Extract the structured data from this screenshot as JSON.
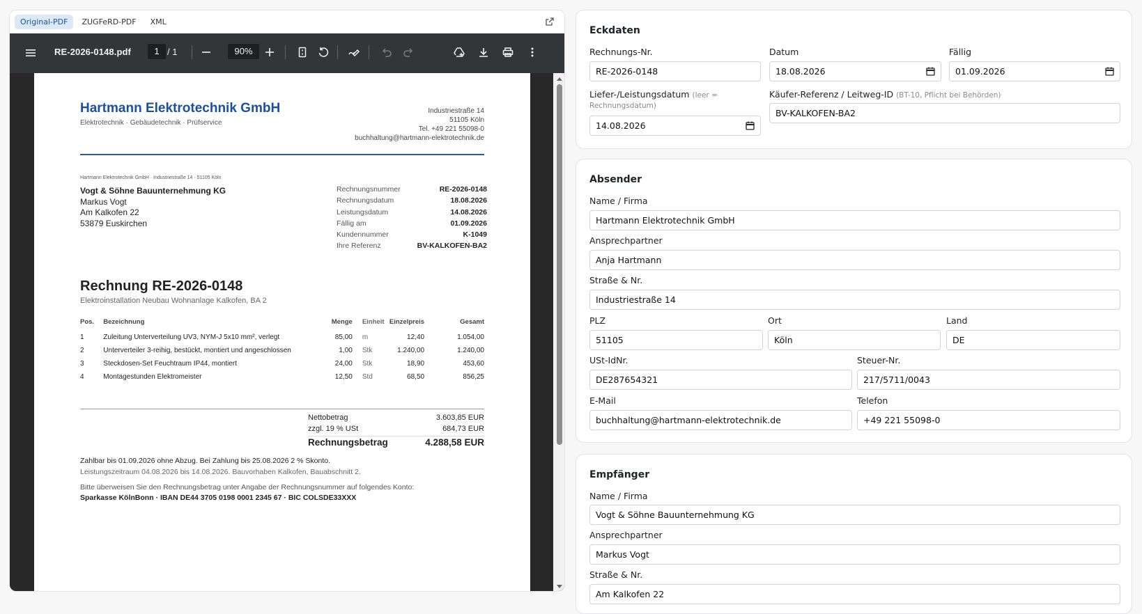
{
  "viewer": {
    "tabs": [
      {
        "label": "Original-PDF",
        "active": true
      },
      {
        "label": "ZUGFeRD-PDF",
        "active": false
      },
      {
        "label": "XML",
        "active": false
      }
    ]
  },
  "pdf_toolbar": {
    "filename": "RE-2026-0148.pdf",
    "page_current": "1",
    "page_total": "/  1",
    "zoom": "90%"
  },
  "invoice": {
    "company_name": "Hartmann Elektrotechnik GmbH",
    "company_tagline": "Elektrotechnik · Gebäudetechnik · Prüfservice",
    "company_address": [
      "Industriestraße 14",
      "51105 Köln",
      "Tel. +49 221 55098-0",
      "buchhaltung@hartmann-elektrotechnik.de"
    ],
    "sender_line": "Hartmann Elektrotechnik GmbH · Industriestraße 14 · 51105 Köln",
    "recipient": [
      "Vogt & Söhne Bauunternehmung KG",
      "Markus Vogt",
      "Am Kalkofen 22",
      "53879 Euskirchen"
    ],
    "meta": [
      {
        "k": "Rechnungsnummer",
        "v": "RE-2026-0148"
      },
      {
        "k": "Rechnungsdatum",
        "v": "18.08.2026"
      },
      {
        "k": "Leistungsdatum",
        "v": "14.08.2026"
      },
      {
        "k": "Fällig am",
        "v": "01.09.2026"
      },
      {
        "k": "Kundennummer",
        "v": "K-1049"
      },
      {
        "k": "Ihre Referenz",
        "v": "BV-KALKOFEN-BA2"
      }
    ],
    "title": "Rechnung RE-2026-0148",
    "subtitle": "Elektroinstallation Neubau Wohnanlage Kalkofen, BA 2",
    "columns": [
      "Pos.",
      "Bezeichnung",
      "Menge",
      "Einheit",
      "Einzelpreis",
      "Gesamt"
    ],
    "items": [
      {
        "pos": "1",
        "desc": "Zuleitung Unterverteilung UV3, NYM-J 5x10 mm², verlegt",
        "qty": "85,00",
        "unit": "m",
        "price": "12,40",
        "total": "1.054,00"
      },
      {
        "pos": "2",
        "desc": "Unterverteiler 3-reihig, bestückt, montiert und angeschlossen",
        "qty": "1,00",
        "unit": "Stk",
        "price": "1.240,00",
        "total": "1.240,00"
      },
      {
        "pos": "3",
        "desc": "Steckdosen-Set Feuchtraum IP44, montiert",
        "qty": "24,00",
        "unit": "Stk",
        "price": "18,90",
        "total": "453,60"
      },
      {
        "pos": "4",
        "desc": "Montagestunden Elektromeister",
        "qty": "12,50",
        "unit": "Std",
        "price": "68,50",
        "total": "856,25"
      }
    ],
    "totals": [
      {
        "k": "Nettobetrag",
        "v": "3.603,85 EUR"
      },
      {
        "k": "zzgl. 19 % USt",
        "v": "684,73 EUR"
      },
      {
        "k": "Rechnungsbetrag",
        "v": "4.288,58 EUR"
      }
    ],
    "payment_terms": "Zahlbar bis 01.09.2026 ohne Abzug. Bei Zahlung bis 25.08.2026 2 % Skonto.",
    "service_period": "Leistungszeitraum 04.08.2026 bis 14.08.2026. Bauvorhaben Kalkofen, Bauabschnitt 2.",
    "transfer_note": "Bitte überweisen Sie den Rechnungsbetrag unter Angabe der Rechnungsnummer auf folgendes Konto:",
    "bank": "Sparkasse KölnBonn · IBAN DE44 3705 0198 0001 2345 67 · BIC COLSDE33XXX"
  },
  "form": {
    "eckdaten": {
      "title": "Eckdaten",
      "rechnungsnr_label": "Rechnungs-Nr.",
      "rechnungsnr": "RE-2026-0148",
      "datum_label": "Datum",
      "datum": "18.08.2026",
      "faellig_label": "Fällig",
      "faellig": "01.09.2026",
      "liefer_label": "Liefer-/Leistungsdatum",
      "liefer_hint_1": "(leer =",
      "liefer_hint_2": "Rechnungsdatum)",
      "liefer": "14.08.2026",
      "kaeufer_label": "Käufer-Referenz / Leitweg-ID",
      "kaeufer_hint": "(BT-10, Pflicht bei Behörden)",
      "kaeufer": "BV-KALKOFEN-BA2"
    },
    "absender": {
      "title": "Absender",
      "name_label": "Name / Firma",
      "name": "Hartmann Elektrotechnik GmbH",
      "contact_label": "Ansprechpartner",
      "contact": "Anja Hartmann",
      "street_label": "Straße & Nr.",
      "street": "Industriestraße 14",
      "plz_label": "PLZ",
      "plz": "51105",
      "ort_label": "Ort",
      "ort": "Köln",
      "land_label": "Land",
      "land": "DE",
      "ust_label": "USt-IdNr.",
      "ust": "DE287654321",
      "steuer_label": "Steuer-Nr.",
      "steuer": "217/5711/0043",
      "email_label": "E-Mail",
      "email": "buchhaltung@hartmann-elektrotechnik.de",
      "tel_label": "Telefon",
      "tel": "+49 221 55098-0"
    },
    "empfaenger": {
      "title": "Empfänger",
      "name_label": "Name / Firma",
      "name": "Vogt & Söhne Bauunternehmung KG",
      "contact_label": "Ansprechpartner",
      "contact": "Markus Vogt",
      "street_label": "Straße & Nr.",
      "street": "Am Kalkofen 22"
    }
  }
}
